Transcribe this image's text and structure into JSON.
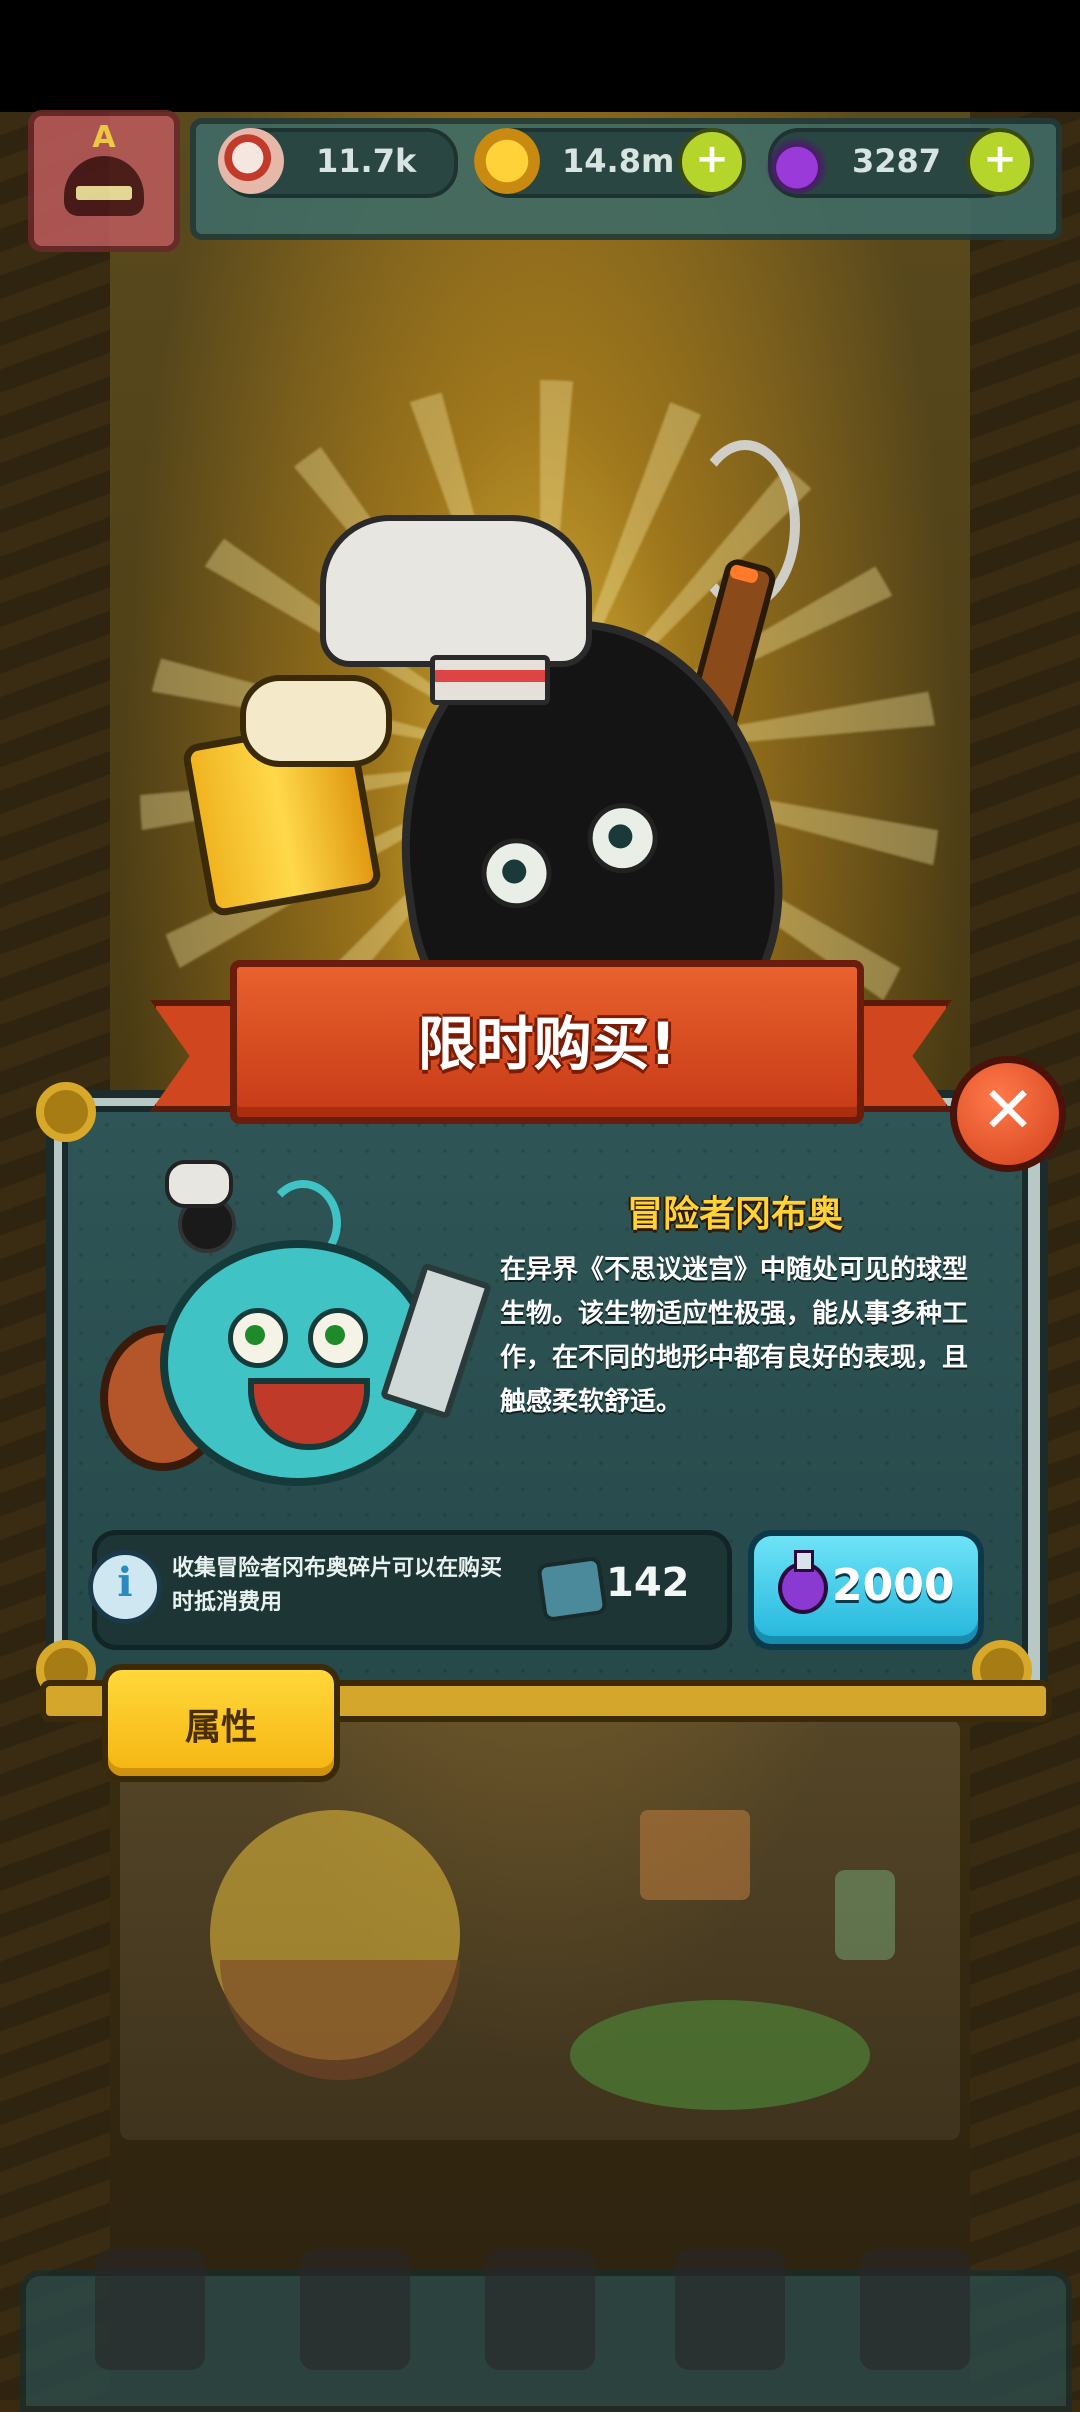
{
  "resources": {
    "eye": {
      "value": "11.7k",
      "icon": "eyeball-icon"
    },
    "coin": {
      "value": "14.8m",
      "icon": "coin-icon"
    },
    "potion": {
      "value": "3287",
      "icon": "potion-icon"
    },
    "plus_glyph": "+"
  },
  "avatar": {
    "letter": "A"
  },
  "banner": {
    "title": "限时购买!"
  },
  "close": {
    "glyph": "✕"
  },
  "hero": {
    "name": "冒险者冈布奥",
    "description": "在异界《不思议迷宫》中随处可见的球型生物。该生物适应性极强，能从事多种工作，在不同的地形中都有良好的表现，且触感柔软舒适。"
  },
  "info": {
    "icon_glyph": "i",
    "text": "收集冒险者冈布奥碎片可以在购买时抵消费用",
    "fragment_count": "142"
  },
  "buy": {
    "price": "2000"
  },
  "tabs": {
    "attributes_label": "属性"
  },
  "colors": {
    "banner_red": "#d0461e",
    "hero_name_yellow": "#ffd23a",
    "buy_cyan": "#22b6dc",
    "attr_yellow": "#f5b512",
    "card_teal": "#2f5556"
  }
}
